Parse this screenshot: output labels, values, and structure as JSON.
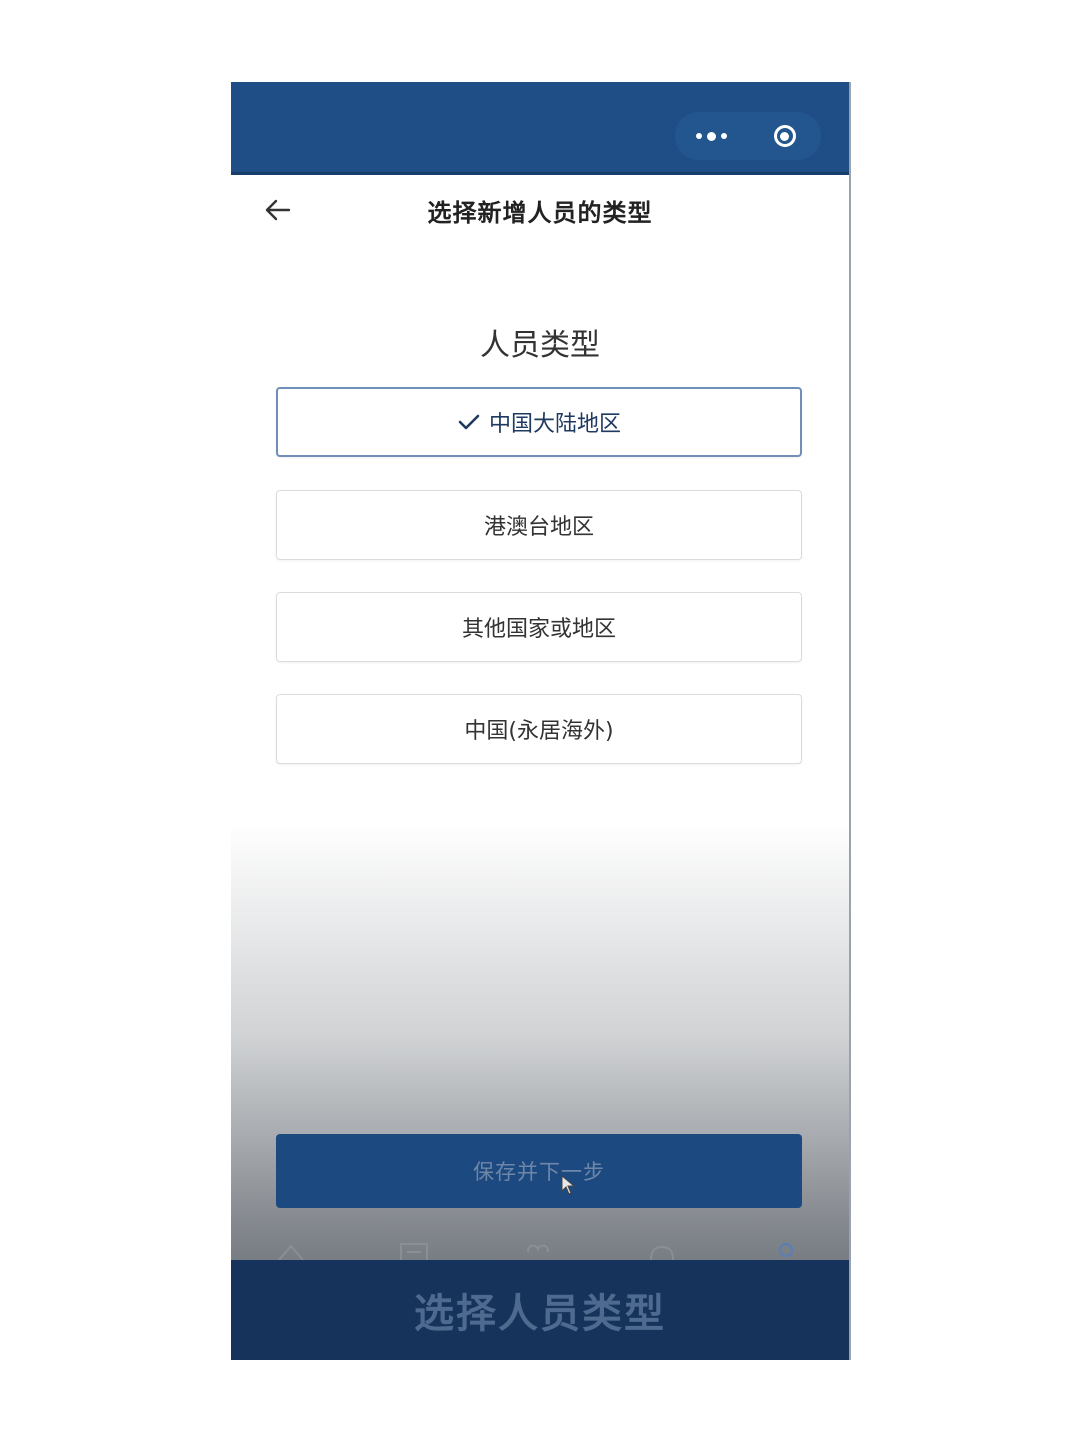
{
  "topbar": {
    "bg_color": "#1f4e86",
    "more_icon": "more-dots-icon",
    "close_icon": "target-circle-icon"
  },
  "nav": {
    "back_icon": "arrow-left-icon",
    "title": "选择新增人员的类型"
  },
  "section": {
    "title": "人员类型"
  },
  "options": [
    {
      "label": "中国大陆地区",
      "selected": true
    },
    {
      "label": "港澳台地区",
      "selected": false
    },
    {
      "label": "其他国家或地区",
      "selected": false
    },
    {
      "label": "中国(永居海外)",
      "selected": false
    }
  ],
  "footer": {
    "save_label": "保存并下一步",
    "accent_color": "#1c4a80"
  },
  "tabbar": {
    "icons": [
      "home-icon",
      "document-icon",
      "heart-icon",
      "message-icon",
      "user-icon"
    ]
  },
  "caption": {
    "text": "选择人员类型"
  }
}
